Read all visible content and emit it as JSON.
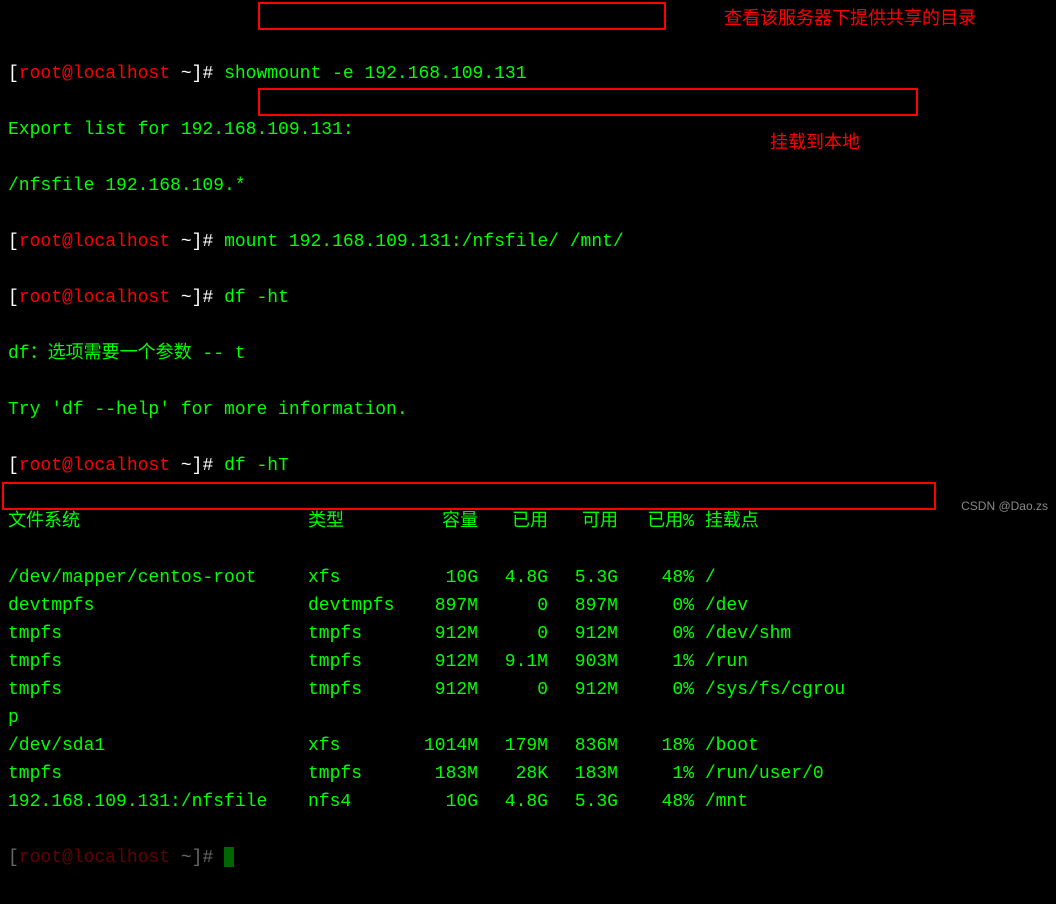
{
  "annotations": {
    "note1": "查看该服务器下提供共享的目录",
    "note2": "挂载到本地"
  },
  "prompt": {
    "open": "[",
    "user": "root@localhost",
    "path": " ~",
    "close": "]# "
  },
  "cmd": {
    "showmount": "showmount -e 192.168.109.131",
    "mount": "mount 192.168.109.131:/nfsfile/ /mnt/",
    "df_ht": "df -ht",
    "df_hT": "df -hT"
  },
  "out": {
    "exportlist": "Export list for 192.168.109.131:",
    "nfsline": "/nfsfile 192.168.109.*",
    "df_err1_a": "df：选项需要一个参数 -- t",
    "df_err2": "Try 'df --help' for more information."
  },
  "df": {
    "header": {
      "fs": "文件系统",
      "type": "类型",
      "size": "容量",
      "used": "已用",
      "avail": "可用",
      "usep": "已用%",
      "mount": "挂载点"
    },
    "rows": [
      {
        "fs": "/dev/mapper/centos-root",
        "type": "xfs",
        "size": "10G",
        "used": "4.8G",
        "avail": "5.3G",
        "usep": "48%",
        "mount": "/"
      },
      {
        "fs": "devtmpfs",
        "type": "devtmpfs",
        "size": "897M",
        "used": "0",
        "avail": "897M",
        "usep": "0%",
        "mount": "/dev"
      },
      {
        "fs": "tmpfs",
        "type": "tmpfs",
        "size": "912M",
        "used": "0",
        "avail": "912M",
        "usep": "0%",
        "mount": "/dev/shm"
      },
      {
        "fs": "tmpfs",
        "type": "tmpfs",
        "size": "912M",
        "used": "9.1M",
        "avail": "903M",
        "usep": "1%",
        "mount": "/run"
      },
      {
        "fs": "tmpfs",
        "type": "tmpfs",
        "size": "912M",
        "used": "0",
        "avail": "912M",
        "usep": "0%",
        "mount": "/sys/fs/cgroup"
      },
      {
        "fs": "/dev/sda1",
        "type": "xfs",
        "size": "1014M",
        "used": "179M",
        "avail": "836M",
        "usep": "18%",
        "mount": "/boot"
      },
      {
        "fs": "tmpfs",
        "type": "tmpfs",
        "size": "183M",
        "used": "28K",
        "avail": "183M",
        "usep": "1%",
        "mount": "/run/user/0"
      },
      {
        "fs": "192.168.109.131:/nfsfile",
        "type": "nfs4",
        "size": "10G",
        "used": "4.8G",
        "avail": "5.3G",
        "usep": "48%",
        "mount": "/mnt"
      }
    ]
  },
  "watermark": "CSDN @Dao.zs"
}
